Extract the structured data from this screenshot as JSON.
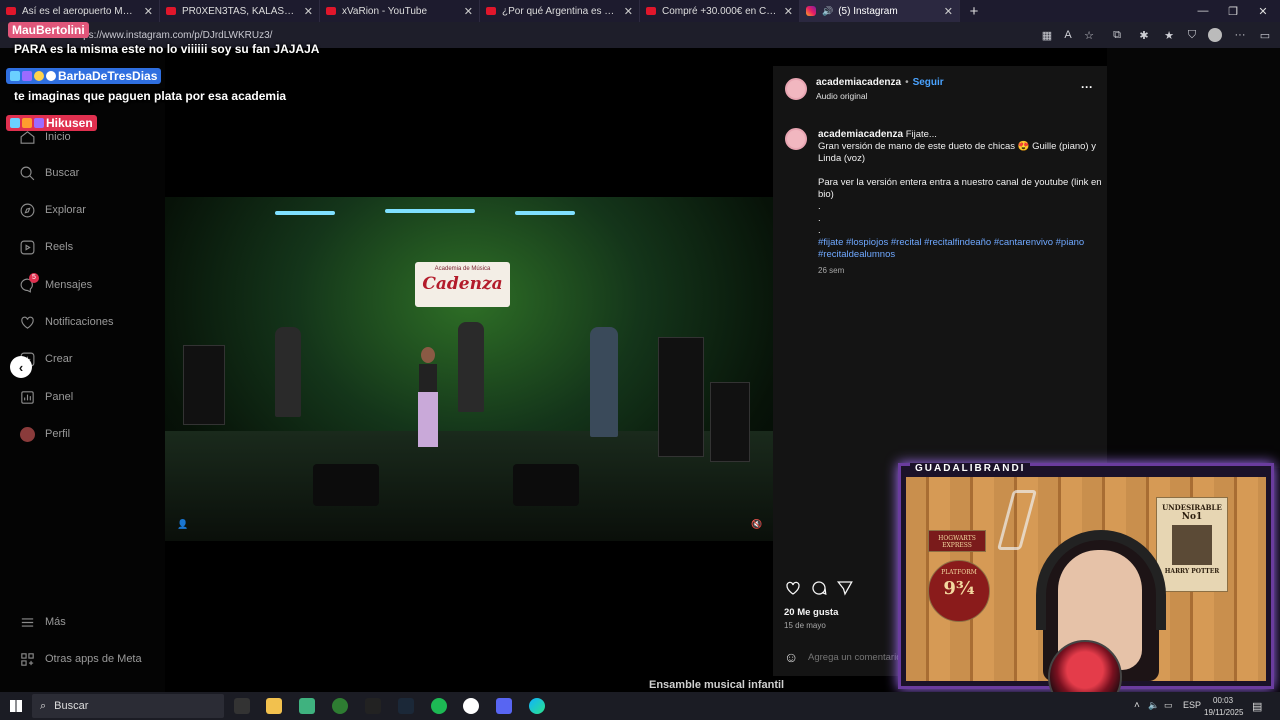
{
  "browser": {
    "tabs": [
      {
        "title": "Así es el aeropuerto MÁS MODERNO",
        "icon": "youtube-icon",
        "active": false
      },
      {
        "title": "PR0XEN3TAS, KALÁSHNIK0V y G...",
        "icon": "youtube-icon",
        "active": false
      },
      {
        "title": "xVaRion - YouTube",
        "icon": "youtube-icon",
        "active": false
      },
      {
        "title": "¿Por qué Argentina es el Mejor País",
        "icon": "youtube-icon",
        "active": false
      },
      {
        "title": "Compré +30.000€ en Cajas Misteriosas",
        "icon": "youtube-icon",
        "active": false
      },
      {
        "title": "(5) Instagram",
        "icon": "instagram-icon",
        "active": true
      }
    ],
    "url": "https://www.instagram.com/p/DJrdLWKRUz3/"
  },
  "chat": [
    {
      "user": "MauBertolini",
      "color": "#e0567a",
      "message": "PARA es la misma este no lo viiiiii soy su fan JAJAJA"
    },
    {
      "user": "BarbaDeTresDias",
      "color": "#2f6fe0",
      "message": "te imaginas que paguen plata por esa academia"
    },
    {
      "user": "Hikusen",
      "color": "#e0304f",
      "message": ""
    }
  ],
  "sidebar": {
    "items": [
      {
        "label": "Inicio",
        "icon": "home-icon"
      },
      {
        "label": "Buscar",
        "icon": "search-icon"
      },
      {
        "label": "Explorar",
        "icon": "compass-icon"
      },
      {
        "label": "Reels",
        "icon": "reels-icon"
      },
      {
        "label": "Mensajes",
        "icon": "messenger-icon"
      },
      {
        "label": "Notificaciones",
        "icon": "heart-icon"
      },
      {
        "label": "Crear",
        "icon": "plus-icon"
      },
      {
        "label": "Panel",
        "icon": "dashboard-icon"
      },
      {
        "label": "Perfil",
        "icon": "profile-icon"
      }
    ],
    "bottom": [
      {
        "label": "Más",
        "icon": "menu-icon"
      },
      {
        "label": "Otras apps de Meta",
        "icon": "meta-apps-icon"
      }
    ],
    "messages_badge": "5"
  },
  "video": {
    "sign_line1": "Academia de Música",
    "sign_line2": "Cadenza"
  },
  "post": {
    "username": "academiacadenza",
    "follow": "Seguir",
    "dot": "•",
    "audio": "Audio original",
    "more": "···",
    "caption_user": "academiacadenza",
    "caption_lines": [
      "Fijate...",
      "Gran versión de mano de este dueto de chicas 😍 Guille (piano) y",
      "Linda (voz)",
      "",
      "Para ver la versión entera entra a nuestro canal de youtube (link en",
      "bio)",
      ".",
      ".",
      "."
    ],
    "hashtags_line1": "#fijate #lospiojos #recital #recitalfindeaño #cantarenvivo #piano",
    "hashtags_line2": "#recitaldealumnos",
    "time_ago": "26 sem",
    "likes": "20 Me gusta",
    "date": "15 de mayo",
    "comment_placeholder": "Agrega un comentario..."
  },
  "background_caption": "Ensamble musical infantil",
  "stream": {
    "cam_label": "GUADALIBRANDI",
    "poster_wanted_title": "UNDESIRABLE",
    "poster_wanted_no": "No1",
    "poster_wanted_name": "HARRY POTTER",
    "platform_text": "PLATFORM",
    "platform_number": "9¾",
    "hogwarts": "HOGWARTS EXPRESS"
  },
  "taskbar": {
    "search": "Buscar",
    "lang": "ESP",
    "time": "00:03",
    "date": "19/11/2025"
  }
}
